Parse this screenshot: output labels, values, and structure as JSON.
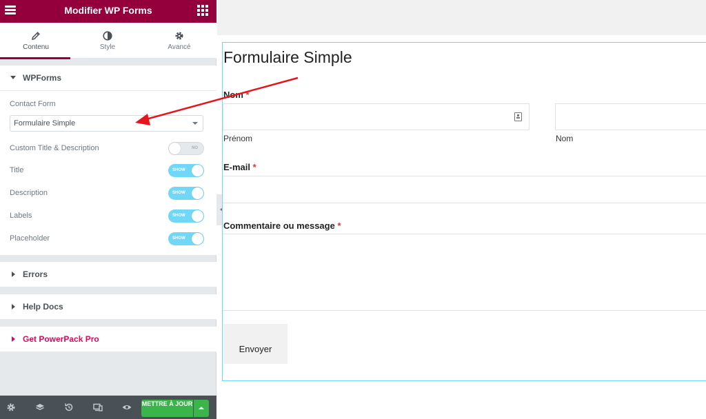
{
  "header": {
    "title": "Modifier WP Forms"
  },
  "tabs": [
    {
      "label": "Contenu",
      "icon": "pencil-icon"
    },
    {
      "label": "Style",
      "icon": "contrast-icon"
    },
    {
      "label": "Avancé",
      "icon": "gear-icon"
    }
  ],
  "sections": {
    "wpforms": {
      "title": "WPForms",
      "contact_form_label": "Contact Form",
      "contact_form_value": "Formulaire Simple",
      "switches": [
        {
          "label": "Custom Title & Description",
          "state": "NO"
        },
        {
          "label": "Title",
          "state": "SHOW"
        },
        {
          "label": "Description",
          "state": "SHOW"
        },
        {
          "label": "Labels",
          "state": "SHOW"
        },
        {
          "label": "Placeholder",
          "state": "SHOW"
        }
      ]
    },
    "errors": {
      "title": "Errors"
    },
    "help_docs": {
      "title": "Help Docs"
    },
    "powerpack": {
      "title": "Get PowerPack Pro"
    }
  },
  "footer": {
    "icons": [
      "gear-icon",
      "layers-icon",
      "history-icon",
      "responsive-icon",
      "eye-icon"
    ],
    "update_label": "METTRE À JOUR"
  },
  "preview": {
    "form_title": "Formulaire Simple",
    "name_label": "Nom",
    "required_mark": "*",
    "first_name_sublabel": "Prénom",
    "last_name_sublabel": "Nom",
    "email_label": "E-mail",
    "message_label": "Commentaire ou message",
    "submit_label": "Envoyer"
  },
  "colors": {
    "brand": "#93003c",
    "accent": "#71d7f7",
    "update": "#39b54a",
    "pink": "#d30c5c",
    "arrow": "#e8141b"
  }
}
